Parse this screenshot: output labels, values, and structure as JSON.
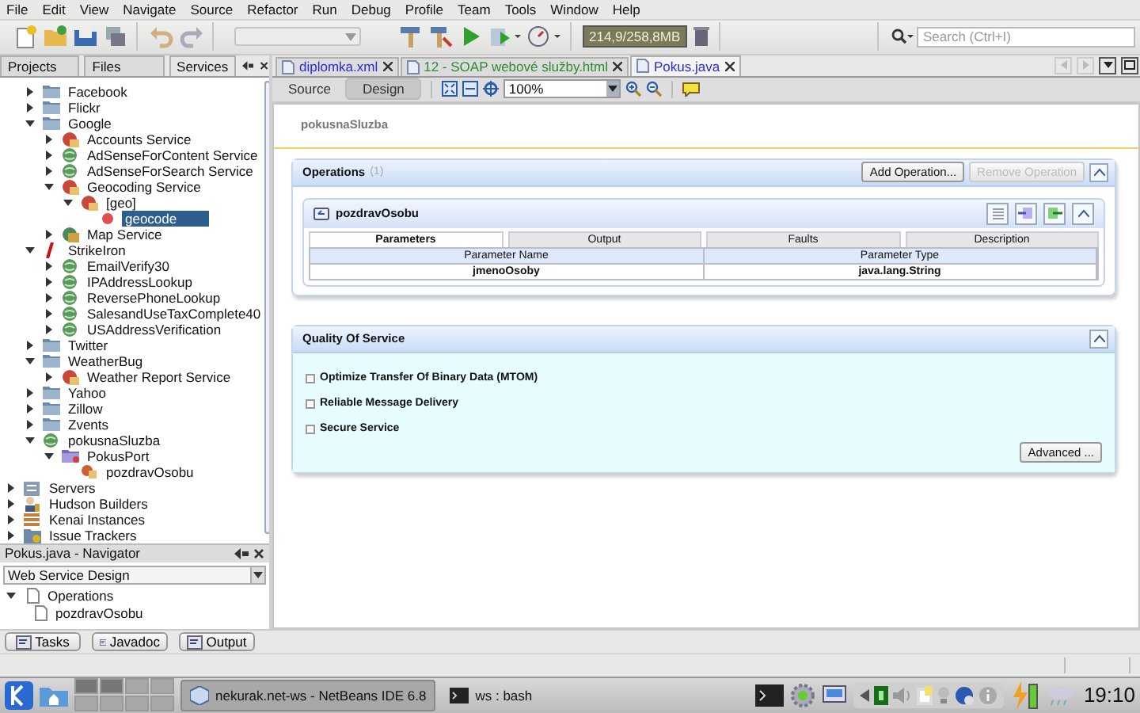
{
  "menu": [
    "File",
    "Edit",
    "View",
    "Navigate",
    "Source",
    "Refactor",
    "Run",
    "Debug",
    "Profile",
    "Team",
    "Tools",
    "Window",
    "Help"
  ],
  "toolbar": {
    "memory": "214,9/258,8MB",
    "search_placeholder": "Search (Ctrl+I)"
  },
  "left_tabs": [
    {
      "label": "Projects",
      "selected": false
    },
    {
      "label": "Files",
      "selected": false
    },
    {
      "label": "Services",
      "selected": true
    }
  ],
  "web_services": [
    {
      "label": "Facebook",
      "kind": "folder",
      "expanded": false,
      "selected": false
    },
    {
      "label": "Flickr",
      "kind": "folder",
      "expanded": false,
      "selected": false
    },
    {
      "label": "Google",
      "kind": "folder",
      "expanded": true,
      "selected": false,
      "children": [
        {
          "label": "Accounts Service",
          "kind": "red_service",
          "expanded": false,
          "selected": false
        },
        {
          "label": "AdSenseForContent Service",
          "kind": "globe",
          "expanded": false,
          "selected": false
        },
        {
          "label": "AdSenseForSearch Service",
          "kind": "globe",
          "expanded": false,
          "selected": false
        },
        {
          "label": "Geocoding Service",
          "kind": "red_service",
          "expanded": true,
          "selected": false,
          "children": [
            {
              "label": "[geo]",
              "kind": "red_service",
              "expanded": true,
              "selected": false,
              "children": [
                {
                  "label": "geocode",
                  "kind": "method",
                  "selected": true
                }
              ]
            }
          ]
        },
        {
          "label": "Map Service",
          "kind": "map",
          "expanded": false,
          "selected": false
        }
      ]
    },
    {
      "label": "StrikeIron",
      "kind": "strikeiron",
      "expanded": true,
      "selected": false,
      "children": [
        {
          "label": "EmailVerify30",
          "kind": "globe",
          "expanded": false,
          "selected": false
        },
        {
          "label": "IPAddressLookup",
          "kind": "globe",
          "expanded": false,
          "selected": false
        },
        {
          "label": "ReversePhoneLookup",
          "kind": "globe",
          "expanded": false,
          "selected": false
        },
        {
          "label": "SalesandUseTaxComplete40",
          "kind": "globe",
          "expanded": false,
          "selected": false
        },
        {
          "label": "USAddressVerification",
          "kind": "globe",
          "expanded": false,
          "selected": false
        }
      ]
    },
    {
      "label": "Twitter",
      "kind": "folder",
      "expanded": false,
      "selected": false
    },
    {
      "label": "WeatherBug",
      "kind": "folder",
      "expanded": true,
      "selected": false,
      "children": [
        {
          "label": "Weather Report Service",
          "kind": "red_service",
          "expanded": false,
          "selected": false
        }
      ]
    },
    {
      "label": "Yahoo",
      "kind": "folder",
      "expanded": false,
      "selected": false
    },
    {
      "label": "Zillow",
      "kind": "folder",
      "expanded": false,
      "selected": false
    },
    {
      "label": "Zvents",
      "kind": "folder",
      "expanded": false,
      "selected": false
    },
    {
      "label": "pokusnaSluzba",
      "kind": "globe",
      "expanded": true,
      "selected": false,
      "children": [
        {
          "label": "PokusPort",
          "kind": "port",
          "expanded": true,
          "selected": false,
          "children": [
            {
              "label": "pozdravOsobu",
              "kind": "operation",
              "selected": false
            }
          ]
        }
      ]
    }
  ],
  "services_tree": [
    {
      "label": "Servers",
      "kind": "server",
      "expanded": false,
      "selected": false
    },
    {
      "label": "Hudson Builders",
      "kind": "hudson",
      "expanded": false,
      "selected": false
    },
    {
      "label": "Kenai Instances",
      "kind": "kenai",
      "expanded": false,
      "selected": false
    },
    {
      "label": "Issue Trackers",
      "kind": "issues",
      "expanded": false,
      "selected": false
    }
  ],
  "navigator": {
    "title": "Pokus.java - Navigator",
    "view": "Web Service Design",
    "tree": [
      {
        "label": "Operations",
        "expanded": true,
        "children": [
          {
            "label": "pozdravOsobu"
          }
        ]
      }
    ]
  },
  "editor_tabs": [
    {
      "label": "diplomka.xml",
      "selected": false,
      "color": "#2a2ad0"
    },
    {
      "label": "12 - SOAP webové služby.html",
      "selected": false,
      "color": "#2f8a2f"
    },
    {
      "label": "Pokus.java",
      "selected": true,
      "color": "#2a2ad0"
    }
  ],
  "design_toolbar": {
    "views": [
      {
        "label": "Source",
        "selected": false
      },
      {
        "label": "Design",
        "selected": true
      }
    ],
    "zoom": "100%"
  },
  "service_name": "pokusnaSluzba",
  "operations": {
    "title": "Operations",
    "count": "(1)",
    "buttons": [
      {
        "label": "Add Operation...",
        "disabled": false
      },
      {
        "label": "Remove Operation",
        "disabled": true
      }
    ],
    "items": [
      {
        "name": "pozdravOsobu",
        "tabs": [
          {
            "label": "Parameters",
            "selected": true
          },
          {
            "label": "Output",
            "selected": false
          },
          {
            "label": "Faults",
            "selected": false
          },
          {
            "label": "Description",
            "selected": false
          }
        ],
        "columns": [
          "Parameter Name",
          "Parameter Type"
        ],
        "rows": [
          [
            "jmenoOsoby",
            "java.lang.String"
          ]
        ]
      }
    ]
  },
  "qos": {
    "title": "Quality Of Service",
    "options": [
      {
        "label": "Optimize Transfer Of Binary Data (MTOM)",
        "checked": false
      },
      {
        "label": "Reliable Message Delivery",
        "checked": false
      },
      {
        "label": "Secure Service",
        "checked": false
      }
    ],
    "button": "Advanced ..."
  },
  "bottom_tabs": [
    "Tasks",
    "Javadoc",
    "Output"
  ],
  "taskbar": {
    "tasks": [
      {
        "label": "nekurak.net-ws - NetBeans IDE 6.8",
        "selected": true
      },
      {
        "label": "ws : bash",
        "selected": false
      }
    ],
    "clock": "19:10"
  }
}
